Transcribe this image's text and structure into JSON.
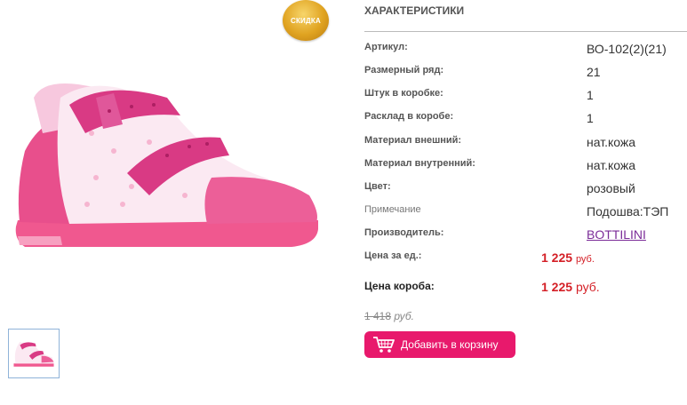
{
  "badge": {
    "label": "СКИДКА"
  },
  "specs": {
    "title": "ХАРАКТЕРИСТИКИ",
    "rows": [
      {
        "label": "Артикул:",
        "value": "ВО-102(2)(21)"
      },
      {
        "label": "Размерный ряд:",
        "value": "21"
      },
      {
        "label": "Штук в коробке:",
        "value": "1"
      },
      {
        "label": "Расклад в коробе:",
        "value": "1"
      },
      {
        "label": "Материал внешний:",
        "value": "нат.кожа"
      },
      {
        "label": "Материал внутренний:",
        "value": "нат.кожа"
      },
      {
        "label": "Цвет:",
        "value": "розовый"
      },
      {
        "label": "Примечание",
        "value": "Подошва:ТЭП"
      },
      {
        "label": "Производитель:",
        "value": "BOTTILINI"
      }
    ],
    "unit_price": {
      "label": "Цена за ед.:",
      "amount": "1 225",
      "currency": "руб."
    },
    "box_price": {
      "label": "Цена короба:",
      "amount": "1 225",
      "currency": "руб."
    },
    "old_price": {
      "amount": "1 418",
      "currency": "руб."
    },
    "add_to_cart": "Добавить в корзину"
  },
  "colors": {
    "accent": "#e8196c",
    "price": "#d41f26",
    "link": "#7b2c98"
  }
}
